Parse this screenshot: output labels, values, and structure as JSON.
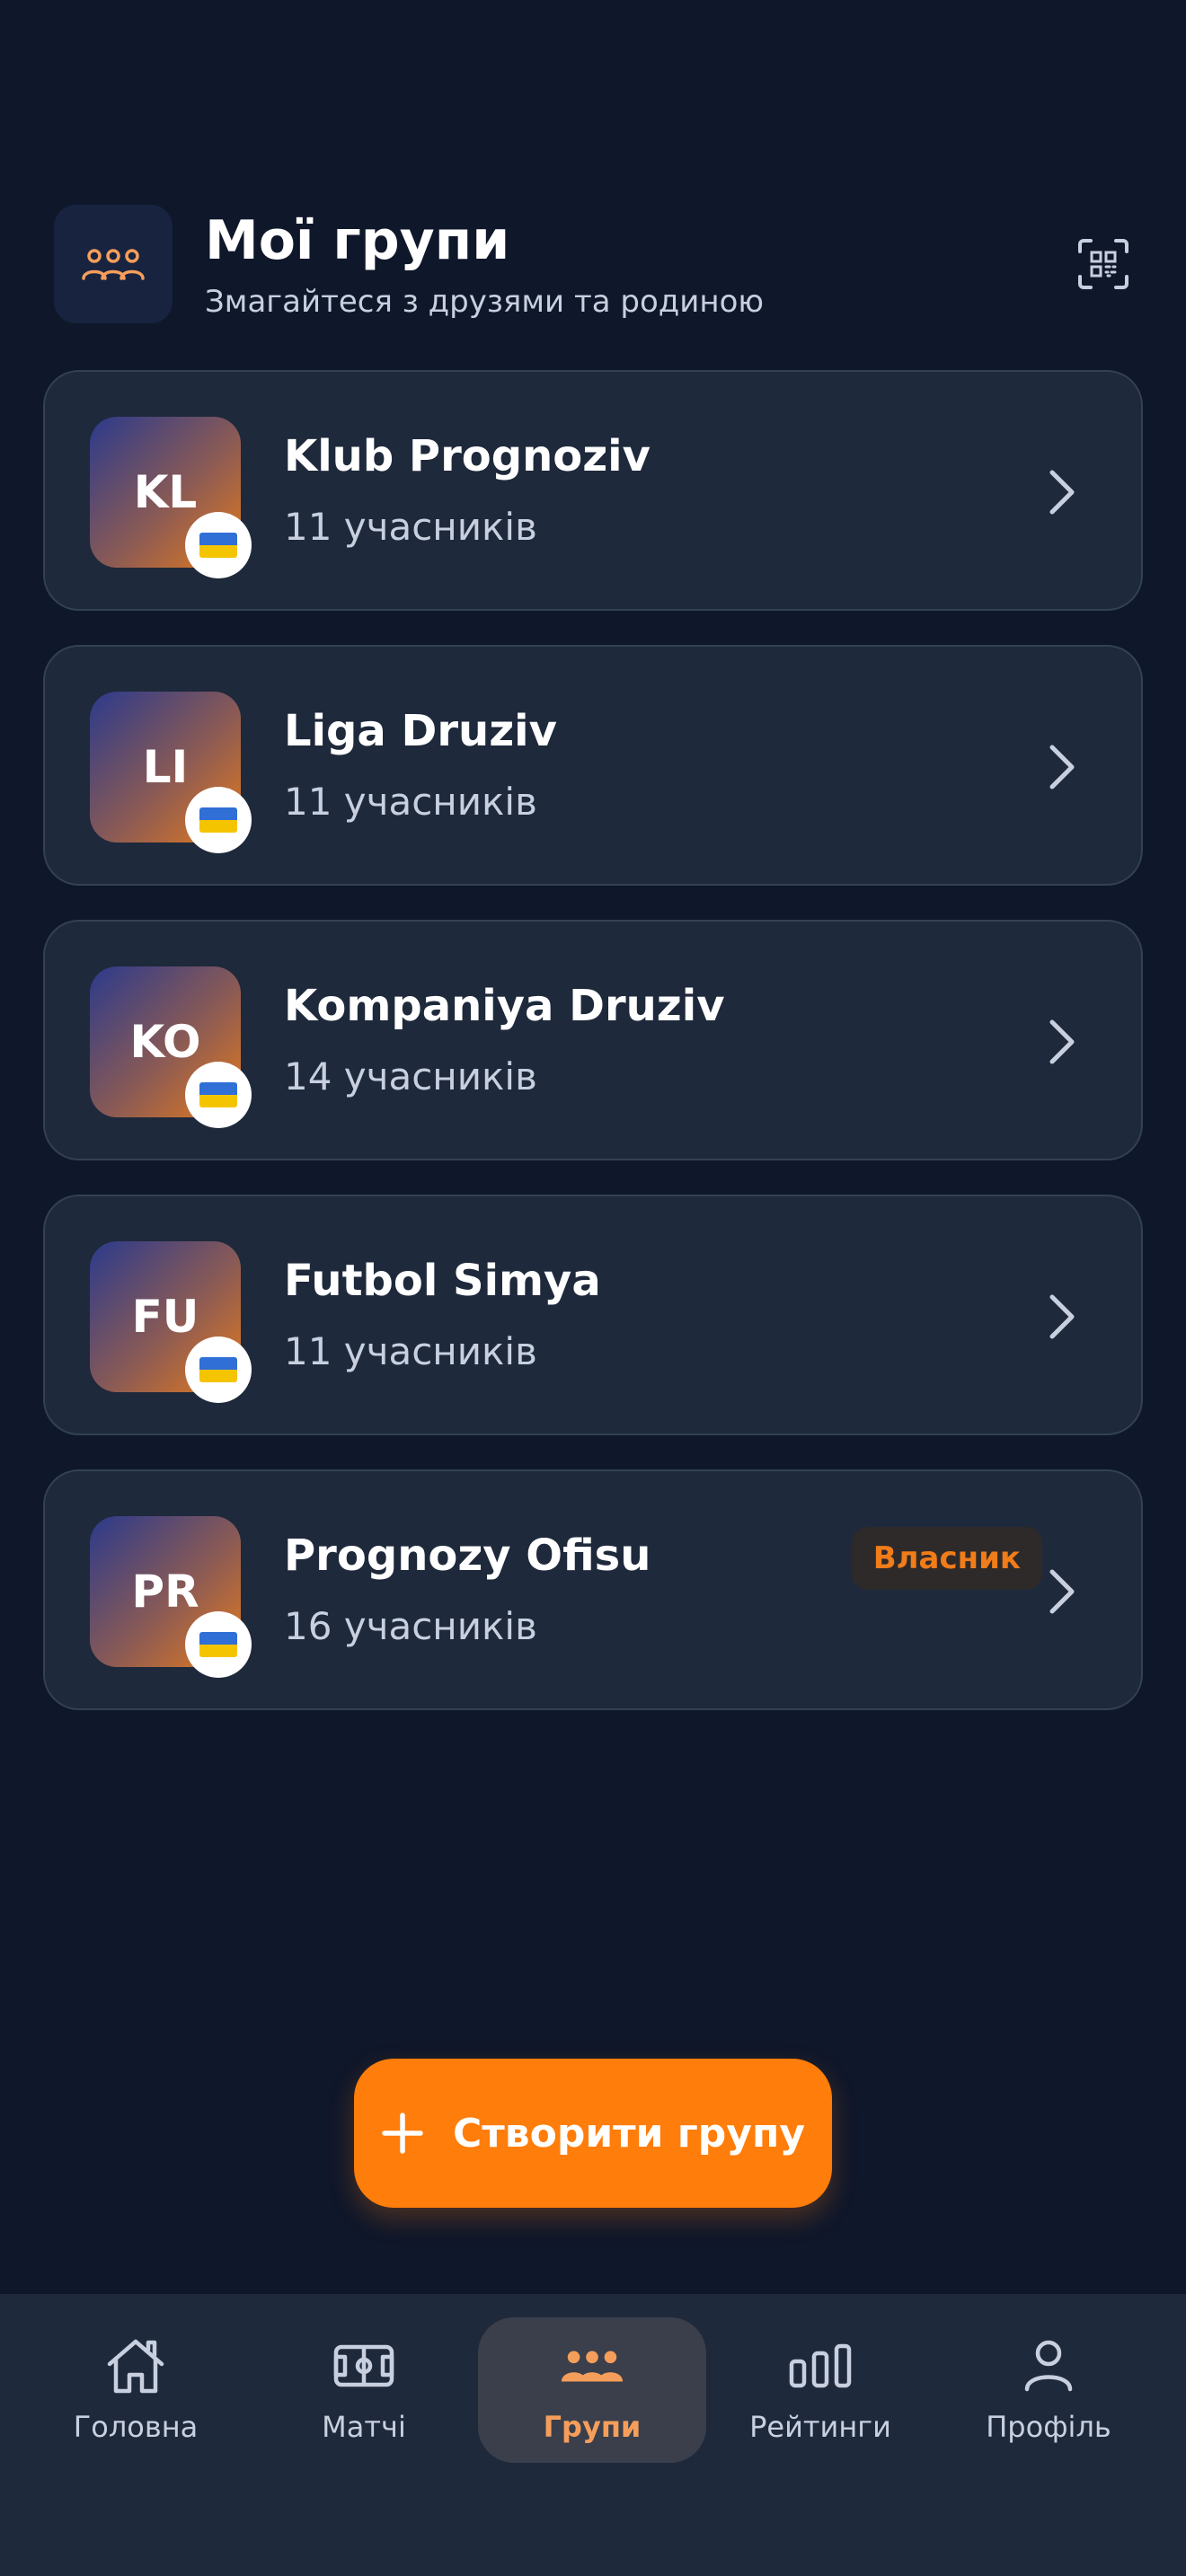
{
  "header": {
    "title": "Мої групи",
    "subtitle": "Змагайтеся з друзями та родиною",
    "icon": "users-icon",
    "qr_icon": "qr-scan-icon"
  },
  "groups": [
    {
      "initials": "KL",
      "name": "Klub Prognoziv",
      "members": "11 учасників",
      "flag": "ukraine-flag",
      "badge": ""
    },
    {
      "initials": "LI",
      "name": "Liga Druziv",
      "members": "11 учасників",
      "flag": "ukraine-flag",
      "badge": ""
    },
    {
      "initials": "KO",
      "name": "Kompaniya Druziv",
      "members": "14 учасників",
      "flag": "ukraine-flag",
      "badge": ""
    },
    {
      "initials": "FU",
      "name": "Futbol Simya",
      "members": "11 учасників",
      "flag": "ukraine-flag",
      "badge": ""
    },
    {
      "initials": "PR",
      "name": "Prognozy Ofisu",
      "members": "16 учасників",
      "flag": "ukraine-flag",
      "badge": "Власник"
    }
  ],
  "create_button": {
    "label": "Створити групу",
    "icon": "plus-icon"
  },
  "nav": {
    "items": [
      {
        "label": "Головна",
        "icon": "home-icon",
        "active": false
      },
      {
        "label": "Матчі",
        "icon": "field-icon",
        "active": false
      },
      {
        "label": "Групи",
        "icon": "users-icon",
        "active": true
      },
      {
        "label": "Рейтинги",
        "icon": "bar-chart-icon",
        "active": false
      },
      {
        "label": "Профіль",
        "icon": "person-icon",
        "active": false
      }
    ]
  },
  "colors": {
    "background": "#0f172a",
    "card": "#1e293b",
    "accent": "#ff7d0a",
    "active_nav_label": "#f59e5b",
    "owner_badge_text": "#f07c1a"
  }
}
